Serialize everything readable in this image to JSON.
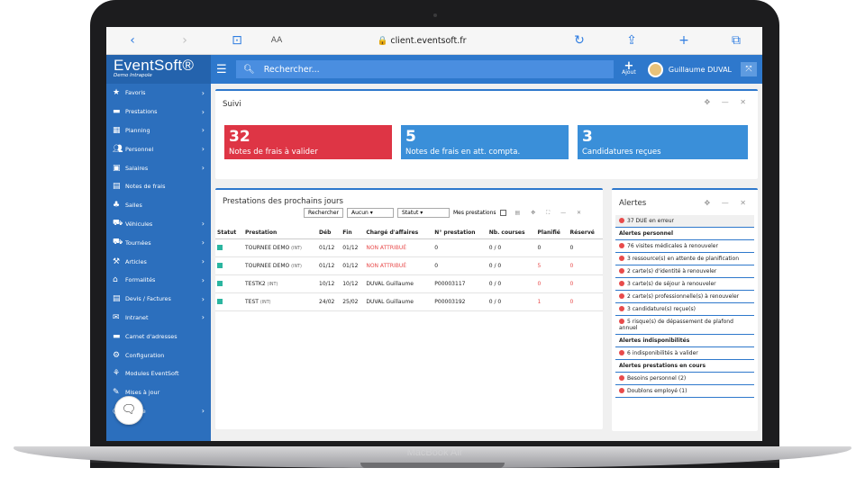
{
  "browser": {
    "url": "client.eventsoft.fr",
    "text_size": "AA"
  },
  "app": {
    "logo": "EventSoft®",
    "sub": "Demo Intrapole"
  },
  "sidebar": {
    "items": [
      {
        "label": "Favoris",
        "icon": "star-icon",
        "chev": true
      },
      {
        "label": "Prestations",
        "icon": "folder-icon",
        "chev": true
      },
      {
        "label": "Planning",
        "icon": "calendar-icon",
        "chev": true
      },
      {
        "label": "Personnel",
        "icon": "users-icon",
        "chev": true
      },
      {
        "label": "Salaires",
        "icon": "money-icon",
        "chev": true
      },
      {
        "label": "Notes de frais",
        "icon": "receipt-icon",
        "chev": false
      },
      {
        "label": "Salles",
        "icon": "sitemap-icon",
        "chev": false
      },
      {
        "label": "Véhicules",
        "icon": "car-icon",
        "chev": true
      },
      {
        "label": "Tournées",
        "icon": "truck-icon",
        "chev": true
      },
      {
        "label": "Articles",
        "icon": "wrench-icon",
        "chev": true
      },
      {
        "label": "Formalités",
        "icon": "bank-icon",
        "chev": true
      },
      {
        "label": "Devis / Factures",
        "icon": "document-icon",
        "chev": true
      },
      {
        "label": "Intranet",
        "icon": "chat-icon",
        "chev": true
      },
      {
        "label": "Carnet d'adresses",
        "icon": "address-book-icon",
        "chev": false
      },
      {
        "label": "Configuration",
        "icon": "gear-icon",
        "chev": false
      },
      {
        "label": "Modules EventSoft",
        "icon": "modules-icon",
        "chev": false
      },
      {
        "label": "Mises à jour",
        "icon": "megaphone-icon",
        "chev": false
      },
      {
        "label": "espace",
        "icon": "space-icon",
        "chev": true
      }
    ]
  },
  "topbar": {
    "search_placeholder": "Rechercher...",
    "add_label": "Ajout",
    "user": "Guillaume DUVAL"
  },
  "suivi": {
    "title": "Suivi",
    "kpis": [
      {
        "num": "32",
        "text": "Notes de frais à valider",
        "color": "#de3545"
      },
      {
        "num": "5",
        "text": "Notes de frais en att. compta.",
        "color": "#3a8fd9"
      },
      {
        "num": "3",
        "text": "Candidatures reçues",
        "color": "#3a8fd9"
      }
    ]
  },
  "prestations": {
    "title": "Prestations des prochains jours",
    "search_button": "Rechercher",
    "filter1": "Aucun",
    "filter2": "Statut",
    "checkbox_label": "Mes prestations",
    "columns": [
      "Statut",
      "Prestation",
      "Déb",
      "Fin",
      "Chargé d'affaires",
      "N° prestation",
      "Nb. courses",
      "Planifié",
      "Réservé"
    ],
    "rows": [
      {
        "name": "TOURNEE DEMO",
        "sub": "(INT)",
        "deb": "01/12",
        "fin": "01/12",
        "charge": "NON ATTRIBUÉ",
        "charge_red": true,
        "num": "0",
        "courses": "0 / 0",
        "planifie": "0",
        "planifie_red": false,
        "reserve": "0",
        "reserve_red": false
      },
      {
        "name": "TOURNEE DEMO",
        "sub": "(INT)",
        "deb": "01/12",
        "fin": "01/12",
        "charge": "NON ATTRIBUÉ",
        "charge_red": true,
        "num": "0",
        "courses": "0 / 0",
        "planifie": "5",
        "planifie_red": true,
        "reserve": "0",
        "reserve_red": true
      },
      {
        "name": "TESTK2",
        "sub": "(INT)",
        "deb": "10/12",
        "fin": "10/12",
        "charge": "DUVAL Guillaume",
        "charge_red": false,
        "num": "P00003117",
        "courses": "0 / 0",
        "planifie": "0",
        "planifie_red": true,
        "reserve": "0",
        "reserve_red": true
      },
      {
        "name": "TEST",
        "sub": "(INT)",
        "deb": "24/02",
        "fin": "25/02",
        "charge": "DUVAL Guillaume",
        "charge_red": false,
        "num": "P00003192",
        "courses": "0 / 0",
        "planifie": "1",
        "planifie_red": true,
        "reserve": "0",
        "reserve_red": true
      }
    ]
  },
  "alertes": {
    "title": "Alertes",
    "items": [
      {
        "type": "alert",
        "text": "37 DUE en erreur",
        "gray": true
      },
      {
        "type": "section",
        "text": "Alertes personnel"
      },
      {
        "type": "alert",
        "text": "76 visites médicales à renouveler"
      },
      {
        "type": "alert",
        "text": "3 ressource(s) en attente de planification"
      },
      {
        "type": "alert",
        "text": "2 carte(s) d'identité à renouveler"
      },
      {
        "type": "alert",
        "text": "3 carte(s) de séjour à renouveler"
      },
      {
        "type": "alert",
        "text": "2 carte(s) professionnelle(s) à renouveler"
      },
      {
        "type": "alert",
        "text": "3 candidature(s) reçue(s)"
      },
      {
        "type": "alert",
        "text": "5 risque(s) de dépassement de plafond annuel"
      },
      {
        "type": "section",
        "text": "Alertes indisponibilités"
      },
      {
        "type": "alert",
        "text": "6 indisponibilités à valider"
      },
      {
        "type": "section",
        "text": "Alertes prestations en cours"
      },
      {
        "type": "alert",
        "text": "Besoins personnel (2)"
      },
      {
        "type": "alert",
        "text": "Doublons employé (1)"
      }
    ]
  },
  "device": {
    "brand": "MacBook Air"
  }
}
